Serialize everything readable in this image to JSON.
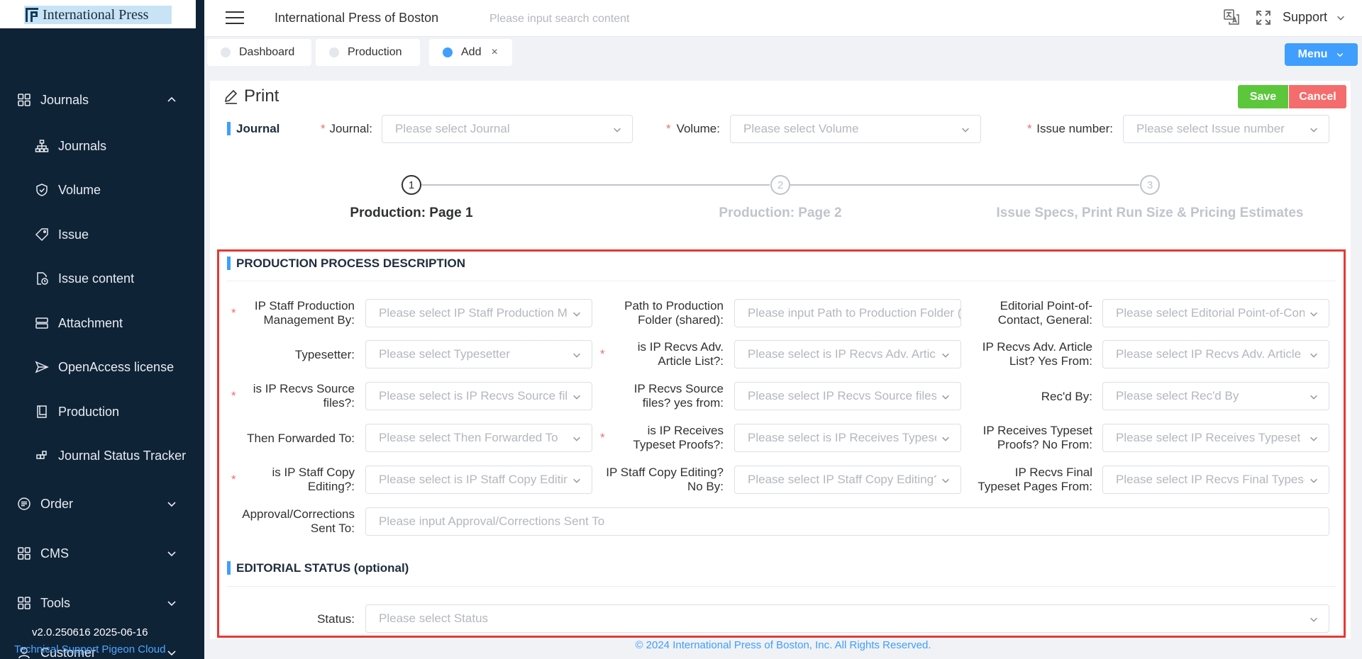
{
  "brand": {
    "logo_text": "International Press"
  },
  "sidebar": {
    "groups": [
      {
        "label": "Journals",
        "expanded": true
      },
      {
        "label": "Order"
      },
      {
        "label": "CMS"
      },
      {
        "label": "Tools"
      },
      {
        "label": "Customer"
      }
    ],
    "journal_items": [
      {
        "label": "Journals",
        "icon": "sitemap-icon"
      },
      {
        "label": "Volume",
        "icon": "shield-check-icon"
      },
      {
        "label": "Issue",
        "icon": "tag-icon"
      },
      {
        "label": "Issue content",
        "icon": "document-clock-icon"
      },
      {
        "label": "Attachment",
        "icon": "server-icon"
      },
      {
        "label": "OpenAccess license",
        "icon": "send-icon"
      },
      {
        "label": "Production",
        "icon": "book-icon"
      },
      {
        "label": "Journal Status Tracker",
        "icon": "connection-icon"
      }
    ],
    "version": "v2.0.250616 2025-06-16",
    "support_link": "Technical Support Pigeon Cloud"
  },
  "header": {
    "org_title": "International Press of Boston",
    "search_placeholder": "Please input search content",
    "support_label": "Support"
  },
  "tabs": [
    {
      "label": "Dashboard",
      "active": false
    },
    {
      "label": "Production",
      "active": false
    },
    {
      "label": "Add",
      "active": true,
      "closable": true
    }
  ],
  "menu_button": "Menu",
  "page": {
    "title": "Print",
    "save": "Save",
    "cancel": "Cancel"
  },
  "journal_section": {
    "title": "Journal",
    "journal_label": "Journal:",
    "journal_placeholder": "Please select Journal",
    "volume_label": "Volume:",
    "volume_placeholder": "Please select Volume",
    "issue_label": "Issue number:",
    "issue_placeholder": "Please select Issue number"
  },
  "steps": [
    {
      "number": "1",
      "title": "Production: Page 1",
      "active": true
    },
    {
      "number": "2",
      "title": "Production: Page 2",
      "active": false
    },
    {
      "number": "3",
      "title": "Issue Specs, Print Run Size & Pricing Estimates",
      "active": false
    }
  ],
  "production_section": {
    "title": "PRODUCTION PROCESS DESCRIPTION",
    "fields": {
      "staff_mgmt_label": "IP Staff Production Management By:",
      "staff_mgmt_ph": "Please select IP Staff Production Management By",
      "path_label": "Path to Production Folder (shared):",
      "path_ph": "Please input Path to Production Folder (shared)",
      "editorial_poc_label": "Editorial Point-of-Contact, General:",
      "editorial_poc_ph": "Please select Editorial Point-of-Contact, General",
      "typesetter_label": "Typesetter:",
      "typesetter_ph": "Please select Typesetter",
      "adv_list_label": "is IP Recvs Adv. Article List?:",
      "adv_list_ph": "Please select is IP Recvs Adv. Article List?",
      "adv_from_label": "IP Recvs Adv. Article List? Yes From:",
      "adv_from_ph": "Please select IP Recvs Adv. Article List? Yes From",
      "source_label": "is IP Recvs Source files?:",
      "source_ph": "Please select is IP Recvs Source files?",
      "source_from_label": "IP Recvs Source files? yes from:",
      "source_from_ph": "Please select IP Recvs Source files? yes from",
      "recd_label": "Rec'd By:",
      "recd_ph": "Please select Rec'd By",
      "forwarded_label": "Then Forwarded To:",
      "forwarded_ph": "Please select Then Forwarded To",
      "proofs_label": "is IP Receives Typeset Proofs?:",
      "proofs_ph": "Please select is IP Receives Typeset Proofs?",
      "proofs_no_label": "IP Receives Typeset Proofs? No From:",
      "proofs_no_ph": "Please select IP Receives Typeset Proofs? No From",
      "copyedit_label": "is IP Staff Copy Editing?:",
      "copyedit_ph": "Please select is IP Staff Copy Editing?",
      "copyedit_no_label": "IP Staff Copy Editing? No By:",
      "copyedit_no_ph": "Please select IP Staff Copy Editing? No By",
      "final_pages_label": "IP Recvs Final Typeset Pages From:",
      "final_pages_ph": "Please select IP Recvs Final Typeset Pages From",
      "approval_label": "Approval/Corrections Sent To:",
      "approval_ph": "Please input Approval/Corrections Sent To"
    }
  },
  "editorial_section": {
    "title": "EDITORIAL STATUS (optional)",
    "status_label": "Status:",
    "status_ph": "Please select Status"
  },
  "footer": "© 2024 International Press of Boston, Inc. All Rights Reserved.",
  "colors": {
    "accent": "#409eff",
    "sidebar_bg": "#0f2337",
    "save": "#5cc73b",
    "cancel": "#f56c6c",
    "required": "#f56c6c",
    "highlight_frame": "#e53935"
  }
}
